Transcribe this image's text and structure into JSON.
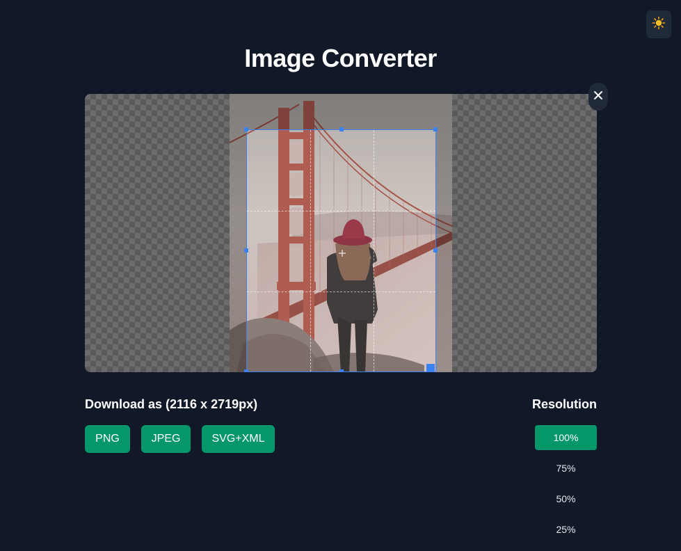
{
  "header": {
    "title": "Image Converter",
    "theme_icon": "sun-icon"
  },
  "editor": {
    "close_icon": "close-icon",
    "image_subject": "photo-golden-gate-bridge"
  },
  "download": {
    "title": "Download as (2116 x 2719px)",
    "formats": [
      "PNG",
      "JPEG",
      "SVG+XML"
    ]
  },
  "resolution": {
    "title": "Resolution",
    "options": [
      "100%",
      "75%",
      "50%",
      "25%"
    ],
    "selected": "100%"
  },
  "colors": {
    "background": "#111827",
    "accent": "#059669",
    "crop": "#3b82f6"
  }
}
